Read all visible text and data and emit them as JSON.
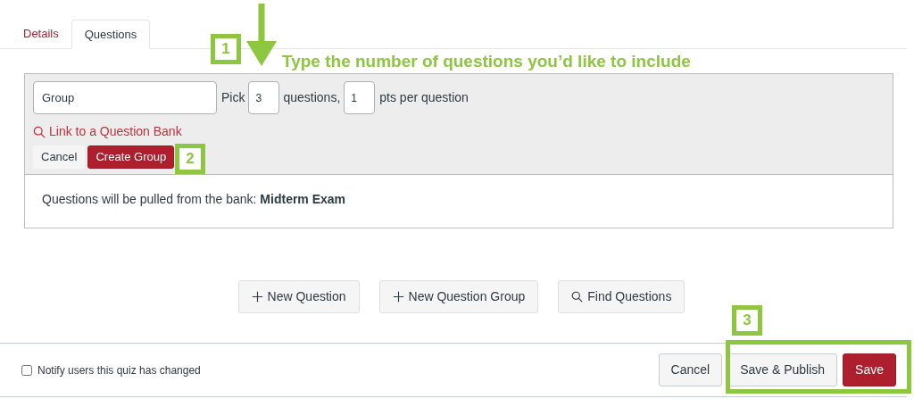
{
  "tabs": [
    {
      "label": "Details",
      "selected": false
    },
    {
      "label": "Questions",
      "selected": true
    }
  ],
  "group_form": {
    "name_value": "Group",
    "pick_label": "Pick",
    "pick_value": "3",
    "questions_label": "questions,",
    "points_value": "1",
    "points_label": "pts per question",
    "link": "Link to a Question Bank",
    "buttons": [
      {
        "label": "Cancel",
        "kind": "secondary"
      },
      {
        "label": "Create Group",
        "kind": "primary"
      }
    ],
    "bank_note": "Questions will be pulled from the bank: **Midterm Exam**"
  },
  "actions": [
    {
      "label": "New Question",
      "kind": "add"
    },
    {
      "label": "New Question Group",
      "kind": "add"
    },
    {
      "label": "Find Questions",
      "kind": "find"
    }
  ],
  "footer": {
    "notify": {
      "label": "Notify users this quiz has changed",
      "checked": false
    },
    "buttons": [
      {
        "label": "Cancel",
        "kind": "secondary"
      },
      {
        "label": "Save & Publish",
        "kind": "secondary"
      },
      {
        "label": "Save",
        "kind": "primary"
      }
    ]
  },
  "annotations": [
    {
      "kind": "arrow"
    },
    {
      "kind": "badge",
      "text": "1"
    },
    {
      "kind": "caption",
      "text": "Type the number of questions you’d like to include"
    },
    {
      "kind": "badge",
      "text": "2"
    },
    {
      "kind": "badge",
      "text": "3"
    },
    {
      "kind": "frame"
    }
  ]
}
